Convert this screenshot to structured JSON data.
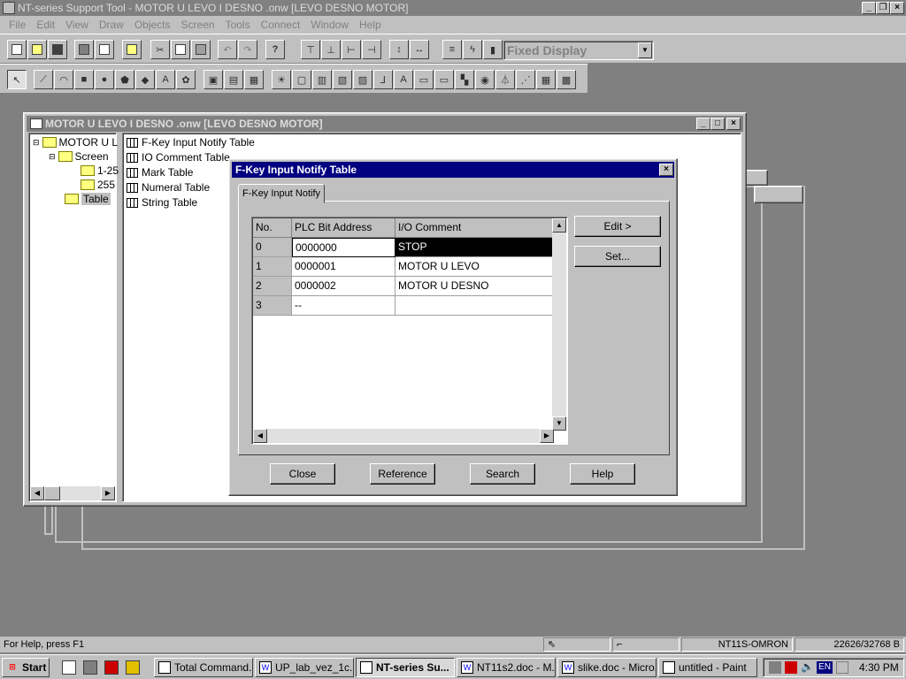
{
  "app": {
    "title": "NT-series Support Tool - MOTOR U LEVO I DESNO  .onw [LEVO DESNO MOTOR]"
  },
  "menu": [
    "File",
    "Edit",
    "View",
    "Draw",
    "Objects",
    "Screen",
    "Tools",
    "Connect",
    "Window",
    "Help"
  ],
  "toolbar": {
    "display_mode": "Fixed Display"
  },
  "project_window": {
    "title": "MOTOR U LEVO I DESNO  .onw  [LEVO DESNO MOTOR]",
    "tree": {
      "root": "MOTOR U L",
      "screen": "Screen",
      "screen_child1": "1-25",
      "screen_child2": "255",
      "table": "Table"
    },
    "tables": [
      "F-Key Input Notify Table",
      "IO Comment Table",
      "Mark Table",
      "Numeral Table",
      "String Table"
    ]
  },
  "dialog": {
    "title": "F-Key Input Notify Table",
    "tab": "F-Key Input Notify",
    "columns": [
      "No.",
      "PLC Bit  Address",
      "I/O Comment"
    ],
    "rows": [
      {
        "no": "0",
        "address": "0000000",
        "comment": "STOP"
      },
      {
        "no": "1",
        "address": "0000001",
        "comment": "MOTOR U LEVO"
      },
      {
        "no": "2",
        "address": "0000002",
        "comment": "MOTOR U DESNO"
      },
      {
        "no": "3",
        "address": "--",
        "comment": ""
      }
    ],
    "buttons": {
      "edit": "Edit >",
      "set": "Set...",
      "close": "Close",
      "reference": "Reference",
      "search": "Search",
      "help": "Help"
    }
  },
  "status": {
    "help": "For Help, press F1",
    "device": "NT11S-OMRON",
    "memory": "22626/32768 B"
  },
  "taskbar": {
    "start": "Start",
    "tasks": [
      "Total Command...",
      "UP_lab_vez_1c...",
      "NT-series Su...",
      "NT11s2.doc - M...",
      "slike.doc - Micro...",
      "untitled - Paint"
    ],
    "lang": "EN",
    "clock": "4:30 PM"
  }
}
